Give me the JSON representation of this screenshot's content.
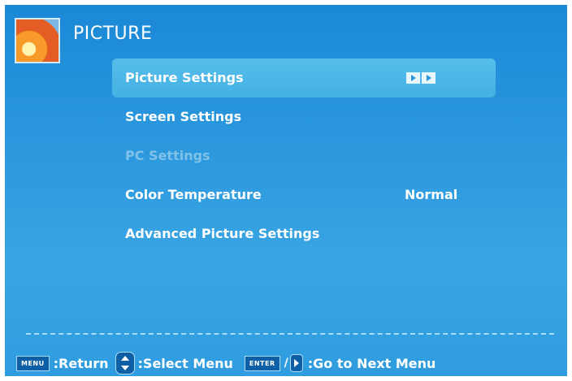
{
  "header": {
    "title": "PICTURE",
    "icon": "picture-flower-icon"
  },
  "menu": {
    "items": [
      {
        "label": "Picture Settings",
        "selected": true,
        "disabled": false,
        "value": "",
        "arrow_icon": "double-right-arrow-icon"
      },
      {
        "label": "Screen Settings",
        "selected": false,
        "disabled": false,
        "value": ""
      },
      {
        "label": "PC Settings",
        "selected": false,
        "disabled": true,
        "value": ""
      },
      {
        "label": "Color Temperature",
        "selected": false,
        "disabled": false,
        "value": "Normal"
      },
      {
        "label": "Advanced Picture Settings",
        "selected": false,
        "disabled": false,
        "value": ""
      }
    ]
  },
  "footer": {
    "menu_key": "MENU",
    "return_label": ":Return",
    "select_label": ":Select Menu",
    "enter_key": "ENTER",
    "slash": "/",
    "next_label": ":Go to Next Menu"
  },
  "colors": {
    "background": "#2a97de",
    "selected_row": "#4fb8e8",
    "disabled_text": "#7fc1e8",
    "text": "#ffffff"
  }
}
